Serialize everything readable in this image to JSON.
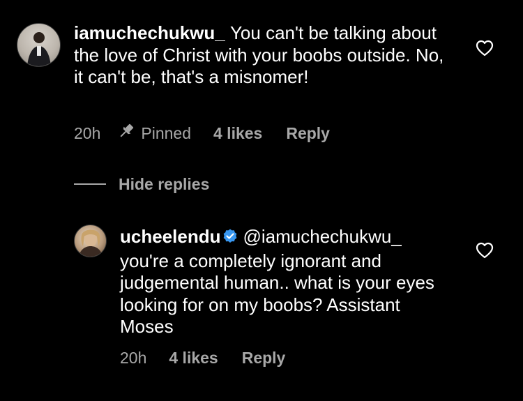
{
  "comment": {
    "username": "iamuchechukwu_",
    "text": "You can't be talking about the love of Christ with your boobs outside. No, it can't be, that's a misnomer!",
    "time": "20h",
    "pinned_label": "Pinned",
    "likes": "4 likes",
    "reply_label": "Reply"
  },
  "replies_toggle": {
    "label": "Hide replies"
  },
  "reply": {
    "username": "ucheelendu",
    "mention": "@iamuchechukwu_",
    "text": "you're a completely ignorant and judgemental human.. what is your eyes looking for on my boobs? Assistant Moses",
    "time": "20h",
    "likes": "4 likes",
    "reply_label": "Reply"
  },
  "icons": {
    "like": "heart-outline-icon",
    "pin": "pin-icon",
    "verified": "verified-badge-icon"
  },
  "colors": {
    "background": "#000000",
    "primary_text": "#ffffff",
    "secondary_text": "#a8a8a8",
    "verified_blue": "#3897f0"
  }
}
